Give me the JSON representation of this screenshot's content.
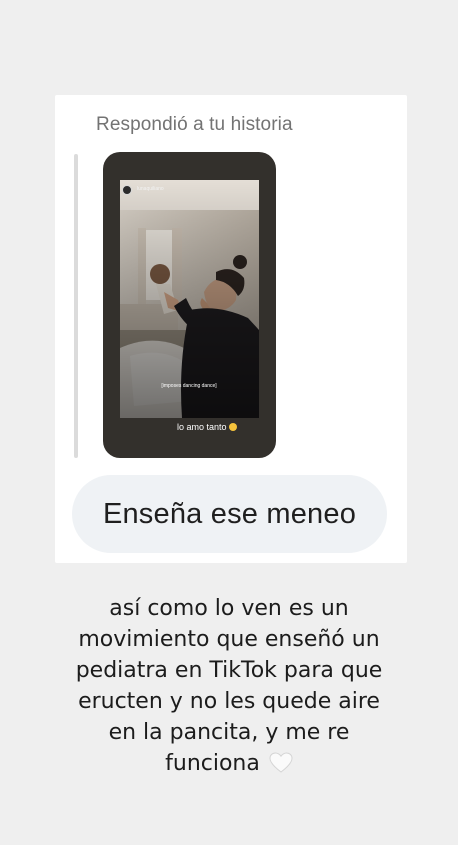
{
  "reply_header": "Respondió a tu historia",
  "story_preview": {
    "username": "lunaquiliano",
    "overlay_text": "[imposes dancing dance]",
    "caption": "lo amo tanto"
  },
  "message": "Enseña ese meneo",
  "story_text": {
    "lines": [
      "así como lo ven es un",
      "movimiento que enseñó un",
      "pediatra en TikTok para que",
      "eructen y no les quede aire",
      "en la pancita, y me re",
      "funciona"
    ]
  },
  "icons": {
    "heart": "white-heart-icon",
    "emoji": "smiling-face-icon"
  },
  "colors": {
    "background": "#efefef",
    "card": "#ffffff",
    "bubble": "#eff2f5",
    "muted_text": "#737373"
  }
}
